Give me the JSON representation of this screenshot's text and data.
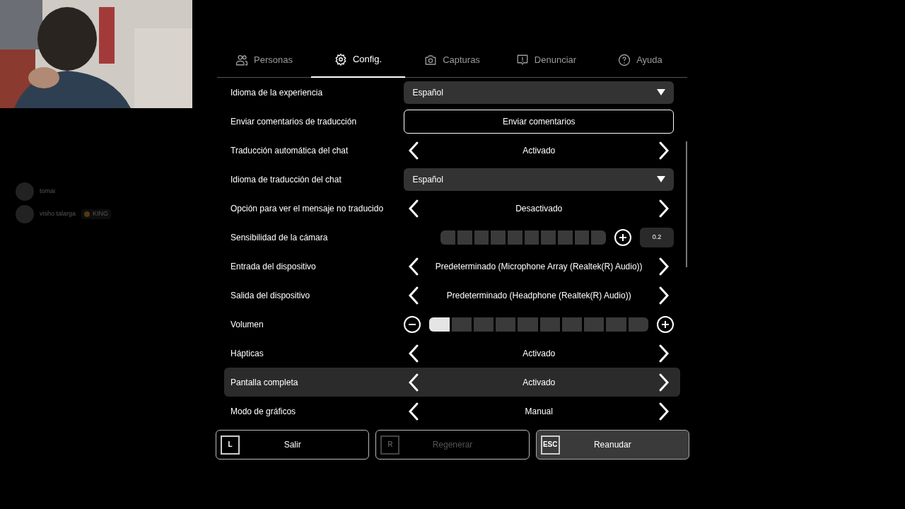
{
  "chat": [
    {
      "name": "tomai"
    },
    {
      "name": "visho talarga",
      "badge": "KING"
    }
  ],
  "tabs": [
    {
      "label": "Personas",
      "selected": false
    },
    {
      "label": "Config.",
      "selected": true
    },
    {
      "label": "Capturas",
      "selected": false
    },
    {
      "label": "Denunciar",
      "selected": false
    },
    {
      "label": "Ayuda",
      "selected": false
    }
  ],
  "settings": [
    {
      "kind": "dropdown",
      "label": "Idioma de la experiencia",
      "value": "Español",
      "selected": false
    },
    {
      "kind": "button",
      "label": "Enviar comentarios de traducción",
      "value": "Enviar comentarios",
      "selected": false
    },
    {
      "kind": "selector",
      "label": "Traducción automática del chat",
      "value": "Activado",
      "selected": false
    },
    {
      "kind": "dropdown",
      "label": "Idioma de traducción del chat",
      "value": "Español",
      "selected": false
    },
    {
      "kind": "selector",
      "label": "Opción para ver el mensaje no traducido",
      "value": "Desactivado",
      "selected": false
    },
    {
      "kind": "stepper",
      "label": "Sensibilidad de la cámara",
      "reading": "0.2",
      "selected": false
    },
    {
      "kind": "selector",
      "label": "Entrada del dispositivo",
      "value": "Predeterminado (Microphone Array (Realtek(R) Audio))",
      "selected": false
    },
    {
      "kind": "selector",
      "label": "Salida del dispositivo",
      "value": "Predeterminado (Headphone (Realtek(R) Audio))",
      "selected": false
    },
    {
      "kind": "slider",
      "label": "Volumen",
      "level": 0.1,
      "selected": false
    },
    {
      "kind": "selector",
      "label": "Hápticas",
      "value": "Activado",
      "selected": false
    },
    {
      "kind": "selector",
      "label": "Pantalla completa",
      "value": "Activado",
      "selected": true
    },
    {
      "kind": "selector",
      "label": "Modo de gráficos",
      "value": "Manual",
      "selected": false
    }
  ],
  "actions": [
    {
      "key": "L",
      "label": "Salir",
      "disabled": false,
      "selected": false
    },
    {
      "key": "R",
      "label": "Regenerar",
      "disabled": true,
      "selected": false
    },
    {
      "key": "ESC",
      "label": "Reanudar",
      "disabled": false,
      "selected": true
    }
  ]
}
